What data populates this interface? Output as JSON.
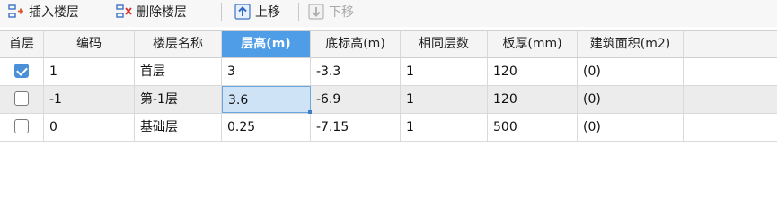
{
  "toolbar": {
    "insert_floor": "插入楼层",
    "delete_floor": "删除楼层",
    "move_up": "上移",
    "move_down": "下移"
  },
  "table": {
    "columns": [
      "首层",
      "编码",
      "楼层名称",
      "层高(m)",
      "底标高(m)",
      "相同层数",
      "板厚(mm)",
      "建筑面积(m2)"
    ],
    "active_column": "层高(m)",
    "rows": [
      {
        "is_first": true,
        "code": "1",
        "name": "首层",
        "height": "3",
        "bottom_elev": "-3.3",
        "same_count": "1",
        "slab": "120",
        "area": "(0)"
      },
      {
        "is_first": false,
        "code": "-1",
        "name": "第-1层",
        "height": "3.6",
        "bottom_elev": "-6.9",
        "same_count": "1",
        "slab": "120",
        "area": "(0)"
      },
      {
        "is_first": false,
        "code": "0",
        "name": "基础层",
        "height": "0.25",
        "bottom_elev": "-7.15",
        "same_count": "1",
        "slab": "500",
        "area": "(0)"
      }
    ],
    "editing_cell": "3.6"
  },
  "colors": {
    "accent": "#4f9de6",
    "checkbox_on": "#4a90d9",
    "edit_bg": "#cfe3f7",
    "row_alt": "#ececec"
  }
}
